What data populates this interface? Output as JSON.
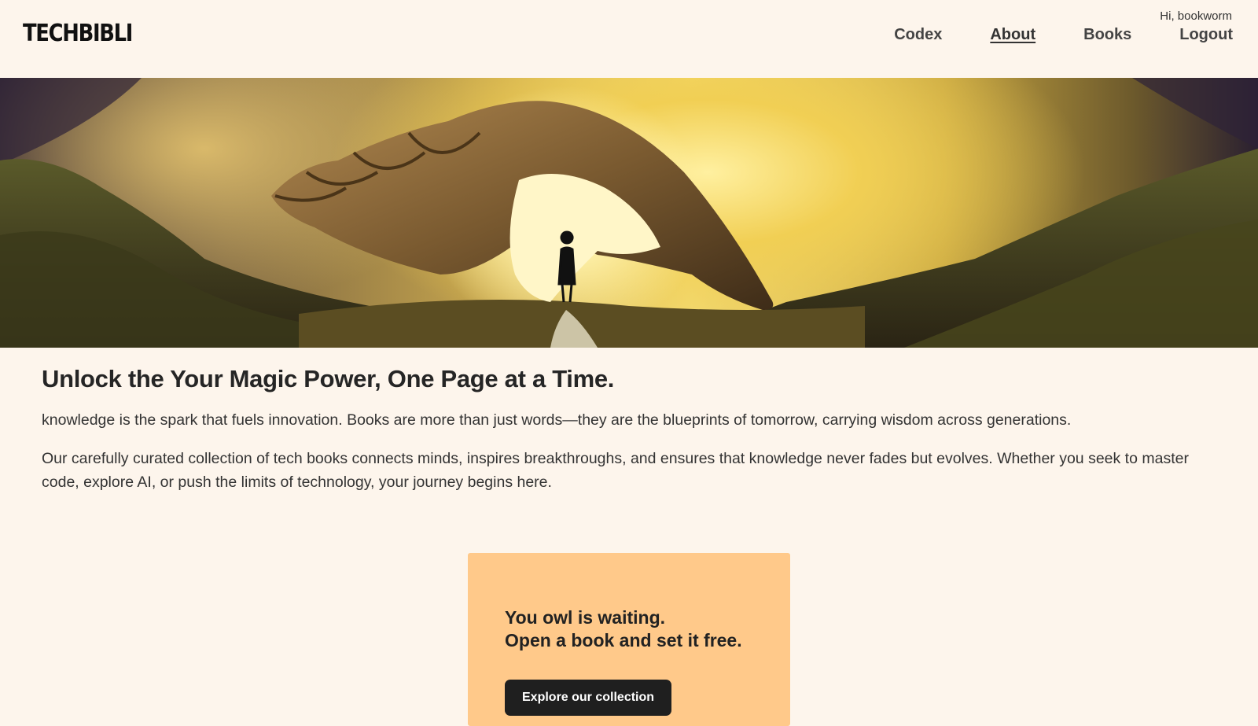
{
  "header": {
    "logo": "TECHBIBLI",
    "greeting": "Hi, bookworm",
    "nav": [
      {
        "label": "Codex",
        "active": false
      },
      {
        "label": "About",
        "active": true
      },
      {
        "label": "Books",
        "active": false
      },
      {
        "label": "Logout",
        "active": false
      }
    ]
  },
  "hero": {
    "image_description": "giant-seashell-fantasy-landscape"
  },
  "main": {
    "headline": "Unlock the Your Magic Power, One Page at a Time.",
    "paragraph1": "knowledge is the spark that fuels innovation. Books are more than just words—they are the blueprints of tomorrow, carrying wisdom across generations.",
    "paragraph2": "Our carefully curated collection of tech books connects minds, inspires breakthroughs, and ensures that knowledge never fades but evolves. Whether you seek to master code, explore AI, or push the limits of technology, your journey begins here."
  },
  "cta": {
    "line1": "You owl is waiting.",
    "line2": "Open a book and set it free.",
    "button_label": "Explore our collection"
  },
  "colors": {
    "background": "#fdf5ec",
    "cta_background": "#ffc98a",
    "button_background": "#1f1f1f"
  }
}
